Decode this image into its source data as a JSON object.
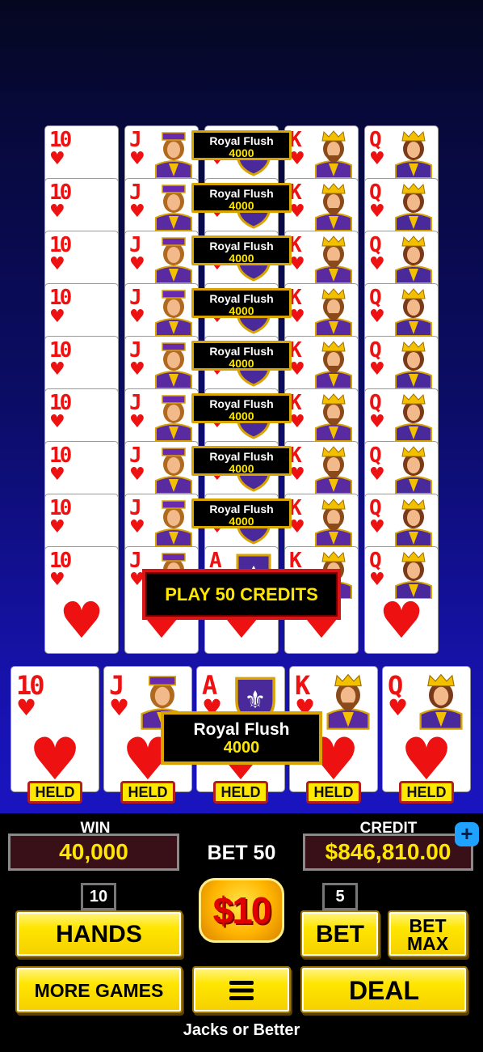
{
  "rows": [
    {
      "cards": [
        {
          "rank": "10",
          "suit": "♥"
        },
        {
          "rank": "J",
          "suit": "♥"
        },
        {
          "rank": "A",
          "suit": "♥"
        },
        {
          "rank": "K",
          "suit": "♥"
        },
        {
          "rank": "Q",
          "suit": "♥"
        }
      ],
      "result": {
        "name": "Royal Flush",
        "payout": "4000"
      }
    },
    {
      "cards": [
        {
          "rank": "10",
          "suit": "♥"
        },
        {
          "rank": "J",
          "suit": "♥"
        },
        {
          "rank": "A",
          "suit": "♥"
        },
        {
          "rank": "K",
          "suit": "♥"
        },
        {
          "rank": "Q",
          "suit": "♥"
        }
      ],
      "result": {
        "name": "Royal Flush",
        "payout": "4000"
      }
    },
    {
      "cards": [
        {
          "rank": "10",
          "suit": "♥"
        },
        {
          "rank": "J",
          "suit": "♥"
        },
        {
          "rank": "A",
          "suit": "♥"
        },
        {
          "rank": "K",
          "suit": "♥"
        },
        {
          "rank": "Q",
          "suit": "♥"
        }
      ],
      "result": {
        "name": "Royal Flush",
        "payout": "4000"
      }
    },
    {
      "cards": [
        {
          "rank": "10",
          "suit": "♥"
        },
        {
          "rank": "J",
          "suit": "♥"
        },
        {
          "rank": "A",
          "suit": "♥"
        },
        {
          "rank": "K",
          "suit": "♥"
        },
        {
          "rank": "Q",
          "suit": "♥"
        }
      ],
      "result": {
        "name": "Royal Flush",
        "payout": "4000"
      }
    },
    {
      "cards": [
        {
          "rank": "10",
          "suit": "♥"
        },
        {
          "rank": "J",
          "suit": "♥"
        },
        {
          "rank": "A",
          "suit": "♥"
        },
        {
          "rank": "K",
          "suit": "♥"
        },
        {
          "rank": "Q",
          "suit": "♥"
        }
      ],
      "result": {
        "name": "Royal Flush",
        "payout": "4000"
      }
    },
    {
      "cards": [
        {
          "rank": "10",
          "suit": "♥"
        },
        {
          "rank": "J",
          "suit": "♥"
        },
        {
          "rank": "A",
          "suit": "♥"
        },
        {
          "rank": "K",
          "suit": "♥"
        },
        {
          "rank": "Q",
          "suit": "♥"
        }
      ],
      "result": {
        "name": "Royal Flush",
        "payout": "4000"
      }
    },
    {
      "cards": [
        {
          "rank": "10",
          "suit": "♥"
        },
        {
          "rank": "J",
          "suit": "♥"
        },
        {
          "rank": "A",
          "suit": "♥"
        },
        {
          "rank": "K",
          "suit": "♥"
        },
        {
          "rank": "Q",
          "suit": "♥"
        }
      ],
      "result": {
        "name": "Royal Flush",
        "payout": "4000"
      }
    },
    {
      "cards": [
        {
          "rank": "10",
          "suit": "♥"
        },
        {
          "rank": "J",
          "suit": "♥"
        },
        {
          "rank": "A",
          "suit": "♥"
        },
        {
          "rank": "K",
          "suit": "♥"
        },
        {
          "rank": "Q",
          "suit": "♥"
        }
      ],
      "result": {
        "name": "Royal Flush",
        "payout": "4000"
      }
    },
    {
      "cards": [
        {
          "rank": "10",
          "suit": "♥"
        },
        {
          "rank": "J",
          "suit": "♥"
        },
        {
          "rank": "A",
          "suit": "♥"
        },
        {
          "rank": "K",
          "suit": "♥"
        },
        {
          "rank": "Q",
          "suit": "♥"
        }
      ],
      "result": null
    }
  ],
  "play_banner": "PLAY 50 CREDITS",
  "main_hand": {
    "cards": [
      {
        "rank": "10",
        "suit": "♥"
      },
      {
        "rank": "J",
        "suit": "♥"
      },
      {
        "rank": "A",
        "suit": "♥"
      },
      {
        "rank": "K",
        "suit": "♥"
      },
      {
        "rank": "Q",
        "suit": "♥"
      }
    ],
    "held_label": "HELD",
    "result": {
      "name": "Royal Flush",
      "payout": "4000"
    }
  },
  "panel": {
    "win_label": "WIN",
    "win_value": "40,000",
    "bet_display": "BET 50",
    "credit_label": "CREDIT",
    "credit_value": "$846,810.00",
    "add_credits_symbol": "+",
    "hands_count": "10",
    "hands_label": "HANDS",
    "denomination": "$10",
    "bet_count": "5",
    "bet_label": "BET",
    "bet_max_line1": "BET",
    "bet_max_line2": "MAX",
    "more_games_label": "MORE GAMES",
    "menu_icon": "hamburger-menu-icon",
    "deal_label": "DEAL",
    "game_name": "Jacks or Better"
  },
  "colors": {
    "card_red": "#ee1111",
    "label_border": "#d9a300",
    "payout_yellow": "#ffe600",
    "button_yellow": "#ffe600",
    "play_border": "#d91515",
    "plus_blue": "#1fa2ff"
  }
}
